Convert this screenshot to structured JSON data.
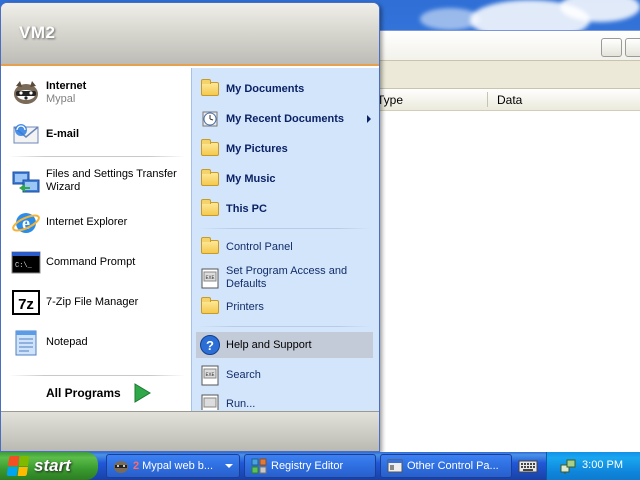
{
  "start_menu": {
    "user_name": "VM2",
    "pinned": [
      {
        "label": "Internet",
        "sublabel": "Mypal",
        "icon": "mypal-raccoon-icon"
      },
      {
        "label": "E-mail",
        "icon": "email-icon"
      }
    ],
    "recent": [
      {
        "label": "Files and Settings Transfer",
        "label2": "Wizard",
        "icon": "transfer-wizard-icon"
      },
      {
        "label": "Internet Explorer",
        "icon": "internet-explorer-icon"
      },
      {
        "label": "Command Prompt",
        "icon": "command-prompt-icon"
      },
      {
        "label": "7-Zip File Manager",
        "icon": "7zip-icon"
      },
      {
        "label": "Notepad",
        "icon": "notepad-icon"
      }
    ],
    "all_programs_label": "All Programs",
    "right_items": {
      "my_documents": "My Documents",
      "my_recent_documents": "My Recent Documents",
      "my_pictures": "My Pictures",
      "my_music": "My Music",
      "this_pc": "This PC",
      "control_panel": "Control Panel",
      "set_program_access": "Set Program Access and",
      "set_program_access2": "Defaults",
      "printers": "Printers",
      "help_and_support": "Help and Support",
      "search": "Search",
      "run": "Run..."
    },
    "highlighted_item": "Help and Support"
  },
  "background_window": {
    "columns": [
      "Type",
      "Data"
    ]
  },
  "taskbar": {
    "start_label": "start",
    "buttons": [
      {
        "count": "2",
        "label": "Mypal web b...",
        "icon": "mypal-raccoon-icon"
      },
      {
        "label": "Registry Editor",
        "icon": "registry-editor-icon"
      },
      {
        "label": "Other Control Pa...",
        "icon": "control-panel-icon"
      }
    ],
    "clock": "3:00 PM"
  },
  "colors": {
    "accent_orange": "#e7a14e",
    "menu_right_bg": "#d3e5fa",
    "highlight_bg": "#c4cbd8",
    "taskbar_blue": "#2157d7",
    "start_green": "#3a9b2f"
  }
}
